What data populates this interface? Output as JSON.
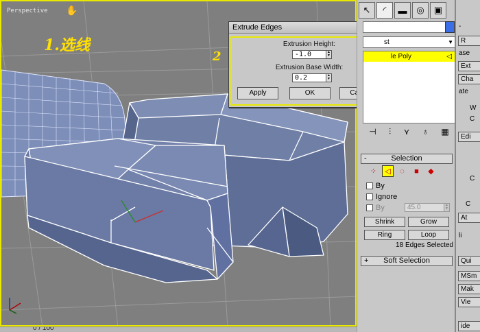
{
  "viewport": {
    "label": "Perspective",
    "annotation_1": "1.选线",
    "annotation_2": "2"
  },
  "timebar": {
    "text": "0 / 100"
  },
  "dialog": {
    "title": "Extrude Edges",
    "close_glyph": "×",
    "height_label": "Extrusion Height:",
    "height_value": "-1.0",
    "base_label": "Extrusion Base Width:",
    "base_value": "0.2",
    "apply_label": "Apply",
    "ok_label": "OK",
    "cancel_label": "Cancel"
  },
  "command_panel": {
    "tabs": [
      "↖",
      "◜",
      "▬",
      "◎",
      "▣",
      "⚒"
    ],
    "modifier_list_text": "st",
    "stack_item": "le Poly",
    "selection": {
      "title": "Selection",
      "by_label": "By",
      "ignore_label": "Ignore",
      "by_angle_label": "By",
      "angle_value": "45.0",
      "shrink_label": "Shrink",
      "grow_label": "Grow",
      "ring_label": "Ring",
      "loop_label": "Loop",
      "status": "18 Edges Selected"
    },
    "soft_selection": {
      "title": "Soft Selection"
    },
    "rollout_minus": "-",
    "rollout_plus": "+"
  },
  "right_strip": {
    "top_sign": "-",
    "items": [
      "R",
      "ase",
      "Ext",
      "Cha",
      "ate",
      "W",
      "C",
      "Edi",
      "C",
      "C",
      "At",
      "li",
      "Qui",
      "MSm",
      "Mak",
      "Vie",
      "ide"
    ]
  },
  "colors": {
    "viewport_border": "#e8e800",
    "stack_selected": "#ffff00",
    "mesh_fill": "#6f7fa6",
    "mesh_wire": "#ffffff"
  }
}
